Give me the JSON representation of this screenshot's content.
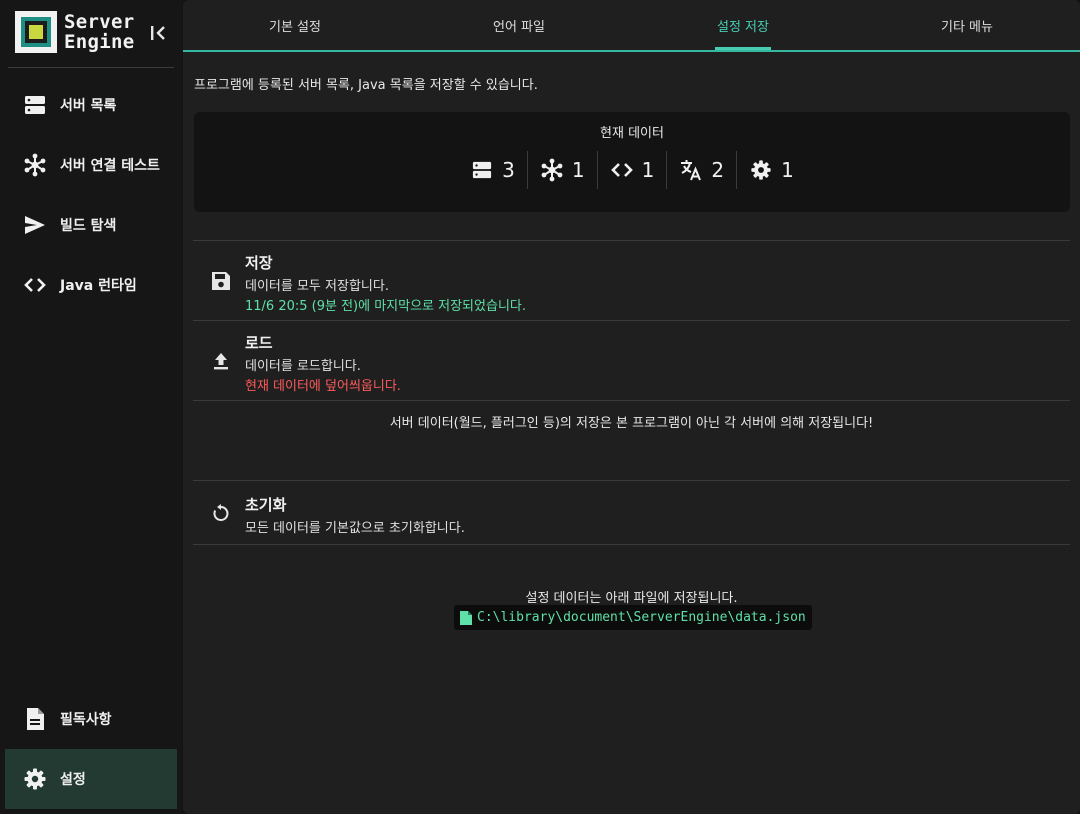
{
  "colors": {
    "accent": "#48cdb3",
    "success": "#5ee0a8",
    "danger": "#ff5a5a",
    "sidebar_active": "#233a32"
  },
  "logo": {
    "line1": "Server",
    "line2": "Engine"
  },
  "sidebar": {
    "items": [
      {
        "label": "서버 목록",
        "icon": "server-list-icon"
      },
      {
        "label": "서버 연결 테스트",
        "icon": "network-icon"
      },
      {
        "label": "빌드 탐색",
        "icon": "send-icon"
      },
      {
        "label": "Java 런타임",
        "icon": "code-icon"
      }
    ],
    "bottom_items": [
      {
        "label": "필독사항",
        "icon": "document-icon"
      },
      {
        "label": "설정",
        "icon": "gear-icon",
        "active": true
      }
    ]
  },
  "tabs": [
    {
      "label": "기본 설정"
    },
    {
      "label": "언어 파일"
    },
    {
      "label": "설정 저장",
      "active": true
    },
    {
      "label": "기타 메뉴"
    }
  ],
  "intro": "프로그램에 등록된 서버 목록, Java 목록을 저장할 수 있습니다.",
  "current_data": {
    "title": "현재 데이터",
    "stats": [
      {
        "icon": "server-list-icon",
        "value": "3"
      },
      {
        "icon": "network-icon",
        "value": "1"
      },
      {
        "icon": "code-icon",
        "value": "1"
      },
      {
        "icon": "translate-icon",
        "value": "2"
      },
      {
        "icon": "gear-icon",
        "value": "1"
      }
    ]
  },
  "save": {
    "title": "저장",
    "desc": "데이터를 모두 저장합니다.",
    "note": "11/6 20:5 (9분 전)에 마지막으로 저장되었습니다."
  },
  "load": {
    "title": "로드",
    "desc": "데이터를 로드합니다.",
    "note": "현재 데이터에 덮어씌웁니다."
  },
  "server_note": "서버 데이터(월드, 플러그인 등)의 저장은 본 프로그램이 아닌 각 서버에 의해 저장됩니다!",
  "reset": {
    "title": "초기화",
    "desc": "모든 데이터를 기본값으로 초기화합니다."
  },
  "file_info": {
    "note": "설정 데이터는 아래 파일에 저장됩니다.",
    "path": "C:\\library\\document\\ServerEngine\\data.json"
  }
}
